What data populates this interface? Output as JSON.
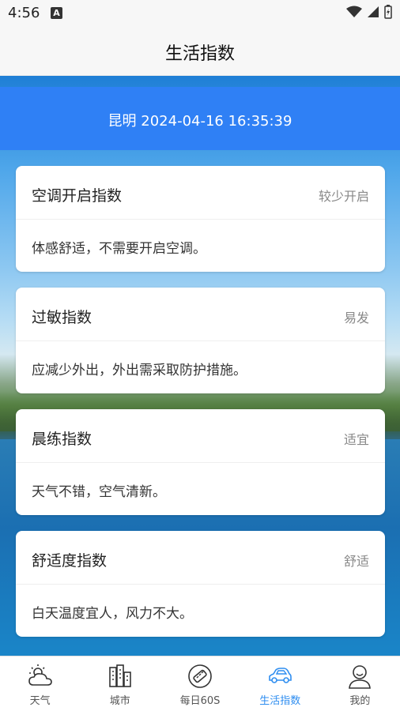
{
  "status": {
    "time": "4:56",
    "notification_glyph": "A"
  },
  "header": {
    "title": "生活指数"
  },
  "location": {
    "text": "昆明 2024-04-16 16:35:39"
  },
  "cards": [
    {
      "title": "空调开启指数",
      "level": "较少开启",
      "desc": "体感舒适，不需要开启空调。"
    },
    {
      "title": "过敏指数",
      "level": "易发",
      "desc": "应减少外出，外出需采取防护措施。"
    },
    {
      "title": "晨练指数",
      "level": "适宜",
      "desc": "天气不错，空气清新。"
    },
    {
      "title": "舒适度指数",
      "level": "舒适",
      "desc": "白天温度宜人，风力不大。"
    }
  ],
  "tabs": [
    {
      "label": "天气",
      "icon": "weather-icon"
    },
    {
      "label": "城市",
      "icon": "city-icon"
    },
    {
      "label": "每日60S",
      "icon": "news-icon"
    },
    {
      "label": "生活指数",
      "icon": "car-icon",
      "active": true
    },
    {
      "label": "我的",
      "icon": "profile-icon"
    }
  ],
  "colors": {
    "accent": "#2f80f5",
    "tab_active": "#2f8ef0"
  }
}
